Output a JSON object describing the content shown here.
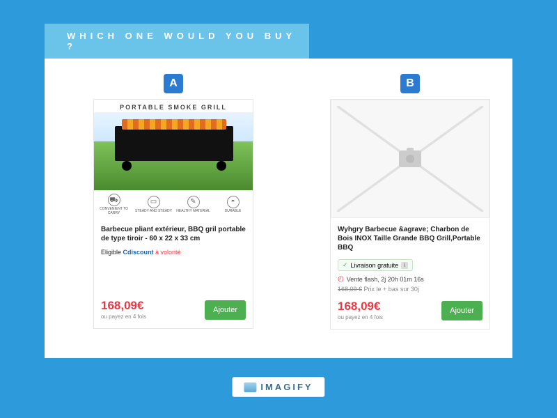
{
  "header": {
    "title": "WHICH ONE WOULD YOU BUY ?"
  },
  "cards": {
    "a": {
      "badge": "A",
      "image_overlay_title": "PORTABLE SMOKE GRILL",
      "features": {
        "f1": "CONVENIENT TO CARRY",
        "f2": "STEADY AND STEADY",
        "f3": "HEALTHY MATERIAL",
        "f4": "DURABLE"
      },
      "title": "Barbecue pliant extérieur, BBQ gril portable de type tiroir - 60 x 22 x 33 cm",
      "eligible_prefix": "Eligible ",
      "eligible_brand": "Cdiscount",
      "eligible_suffix": " à volonté",
      "price": "168,09€",
      "installment": "ou payez en 4 fois",
      "cta": "Ajouter"
    },
    "b": {
      "badge": "B",
      "title": "Wyhgry Barbecue &agrave; Charbon de Bois INOX Taille Grande BBQ Grill,Portable BBQ",
      "free_shipping": "Livraison gratuite",
      "flash_sale": "Vente flash, 2j 20h 01m 16s",
      "old_price_strike": "168,09 €",
      "old_price_note": " Prix le + bas sur 30j",
      "price": "168,09€",
      "installment": "ou payez en 4 fois",
      "cta": "Ajouter"
    }
  },
  "footer": {
    "brand": "IMAGIFY"
  }
}
